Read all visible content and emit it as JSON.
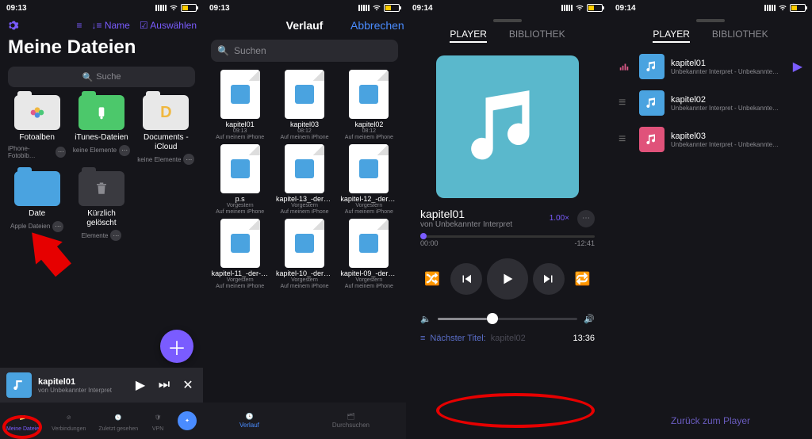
{
  "status": {
    "t1": "09:13",
    "t2": "09:13",
    "t3": "09:14",
    "t4": "09:14"
  },
  "p1": {
    "title": "Meine Dateien",
    "toolbar": {
      "sort": "Name",
      "select": "Auswählen"
    },
    "search": "Suche",
    "tiles": [
      {
        "label": "Fotoalben",
        "sub": "iPhone-Fotobib…"
      },
      {
        "label": "iTunes-Dateien",
        "sub": "keine Elemente"
      },
      {
        "label": "Documents - iCloud",
        "sub": "keine Elemente"
      },
      {
        "label": "Date",
        "sub": "Apple Dateien"
      },
      {
        "label": "Kürzlich gelöscht",
        "sub": "Elemente"
      }
    ],
    "mini": {
      "title": "kapitel01",
      "artist": "von Unbekannter Interpret"
    },
    "tabs": [
      "Meine Dateie",
      "Verbindungen",
      "Zuletzt gesehen",
      "VPN",
      ""
    ]
  },
  "p2": {
    "title": "Verlauf",
    "cancel": "Abbrechen",
    "search": "Suchen",
    "files": [
      {
        "n": "kapitel01",
        "m1": "09:13",
        "m2": "Auf meinem iPhone"
      },
      {
        "n": "kapitel03",
        "m1": "08:12",
        "m2": "Auf meinem iPhone"
      },
      {
        "n": "kapitel02",
        "m1": "08:12",
        "m2": "Auf meinem iPhone"
      },
      {
        "n": "p.s",
        "m1": "Vorgestern",
        "m2": "Auf meinem iPhone"
      },
      {
        "n": "kapitel-13_-der-s…nfang",
        "m1": "Vorgestern",
        "m2": "Auf meinem iPhone"
      },
      {
        "n": "kapitel-12_-der-s…nfang",
        "m1": "Vorgestern",
        "m2": "Auf meinem iPhone"
      },
      {
        "n": "kapitel-11_-der-s…nfang",
        "m1": "Vorgestern",
        "m2": "Auf meinem iPhone"
      },
      {
        "n": "kapitel-10_-der-s…nfang",
        "m1": "Vorgestern",
        "m2": "Auf meinem iPhone"
      },
      {
        "n": "kapitel-09_-der-s…nfang",
        "m1": "Vorgestern",
        "m2": "Auf meinem iPhone"
      }
    ],
    "tabs": {
      "history": "Verlauf",
      "browse": "Durchsuchen"
    }
  },
  "p3": {
    "seg": {
      "player": "PLAYER",
      "lib": "BIBLIOTHEK"
    },
    "track": "kapitel01",
    "artist": "von Unbekannter Interpret",
    "speed": "1.00×",
    "time": {
      "cur": "00:00",
      "rem": "-12:41"
    },
    "next_label": "Nächster Titel:",
    "next": "kapitel02",
    "clock": "13:36"
  },
  "p4": {
    "seg": {
      "player": "PLAYER",
      "lib": "BIBLIOTHEK"
    },
    "queue": [
      {
        "t": "kapitel01",
        "a": "Unbekannter Interpret - Unbekanntes…"
      },
      {
        "t": "kapitel02",
        "a": "Unbekannter Interpret - Unbekanntes…"
      },
      {
        "t": "kapitel03",
        "a": "Unbekannter Interpret - Unbekanntes…"
      }
    ],
    "back": "Zurück zum Player"
  }
}
